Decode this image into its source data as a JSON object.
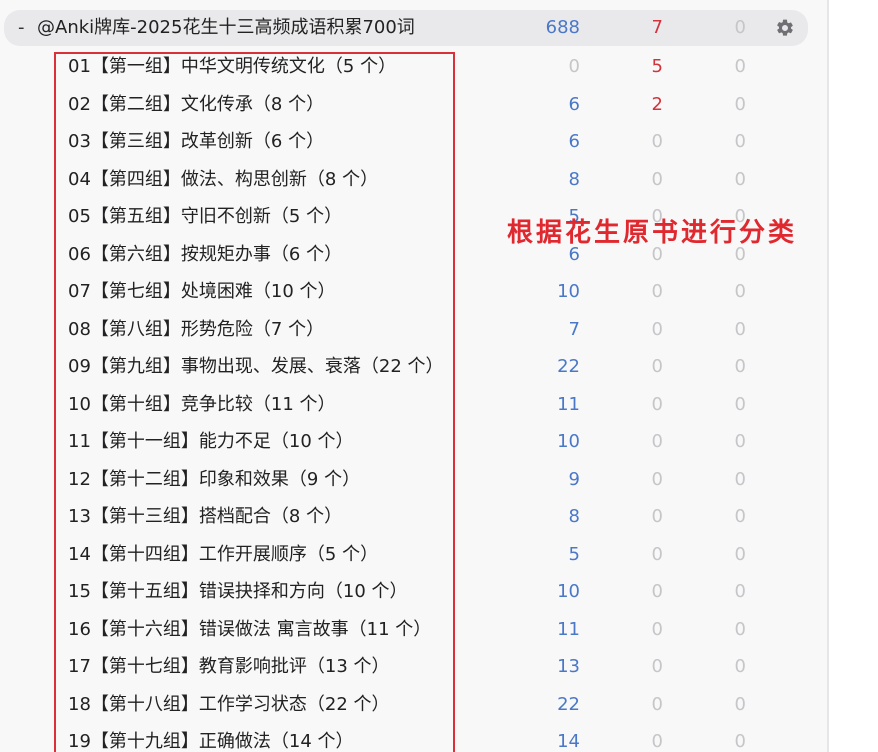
{
  "parent_deck": {
    "collapse_symbol": "-",
    "name": "@Anki牌库-2025花生十三高频成语积累700词",
    "new": "688",
    "learn": "7",
    "due": "0",
    "options_icon": "gear-icon"
  },
  "subdecks": [
    {
      "name": "01【第一组】中华文明传统文化（5 个）",
      "new": "0",
      "learn": "5",
      "due": "0"
    },
    {
      "name": "02【第二组】文化传承（8 个）",
      "new": "6",
      "learn": "2",
      "due": "0"
    },
    {
      "name": "03【第三组】改革创新（6 个）",
      "new": "6",
      "learn": "0",
      "due": "0"
    },
    {
      "name": "04【第四组】做法、构思创新（8 个）",
      "new": "8",
      "learn": "0",
      "due": "0"
    },
    {
      "name": "05【第五组】守旧不创新（5 个）",
      "new": "5",
      "learn": "0",
      "due": "0"
    },
    {
      "name": "06【第六组】按规矩办事（6 个）",
      "new": "6",
      "learn": "0",
      "due": "0"
    },
    {
      "name": "07【第七组】处境困难（10 个）",
      "new": "10",
      "learn": "0",
      "due": "0"
    },
    {
      "name": "08【第八组】形势危险（7 个）",
      "new": "7",
      "learn": "0",
      "due": "0"
    },
    {
      "name": "09【第九组】事物出现、发展、衰落（22 个）",
      "new": "22",
      "learn": "0",
      "due": "0"
    },
    {
      "name": "10【第十组】竞争比较（11 个）",
      "new": "11",
      "learn": "0",
      "due": "0"
    },
    {
      "name": "11【第十一组】能力不足（10 个）",
      "new": "10",
      "learn": "0",
      "due": "0"
    },
    {
      "name": "12【第十二组】印象和效果（9 个）",
      "new": "9",
      "learn": "0",
      "due": "0"
    },
    {
      "name": "13【第十三组】搭档配合（8 个）",
      "new": "8",
      "learn": "0",
      "due": "0"
    },
    {
      "name": "14【第十四组】工作开展顺序（5 个）",
      "new": "5",
      "learn": "0",
      "due": "0"
    },
    {
      "name": "15【第十五组】错误抉择和方向（10 个）",
      "new": "10",
      "learn": "0",
      "due": "0"
    },
    {
      "name": "16【第十六组】错误做法 寓言故事（11 个）",
      "new": "11",
      "learn": "0",
      "due": "0"
    },
    {
      "name": "17【第十七组】教育影响批评（13 个）",
      "new": "13",
      "learn": "0",
      "due": "0"
    },
    {
      "name": "18【第十八组】工作学习状态（22 个）",
      "new": "22",
      "learn": "0",
      "due": "0"
    },
    {
      "name": "19【第十九组】正确做法（14 个）",
      "new": "14",
      "learn": "0",
      "due": "0"
    }
  ],
  "annotation": {
    "text": "根据花生原书进行分类",
    "color": "#e0282f"
  },
  "colors": {
    "new_count": "#4a78c7",
    "learn_count": "#d2323c",
    "zero_count": "#c6c6c9",
    "highlight_border": "#d9303a"
  }
}
